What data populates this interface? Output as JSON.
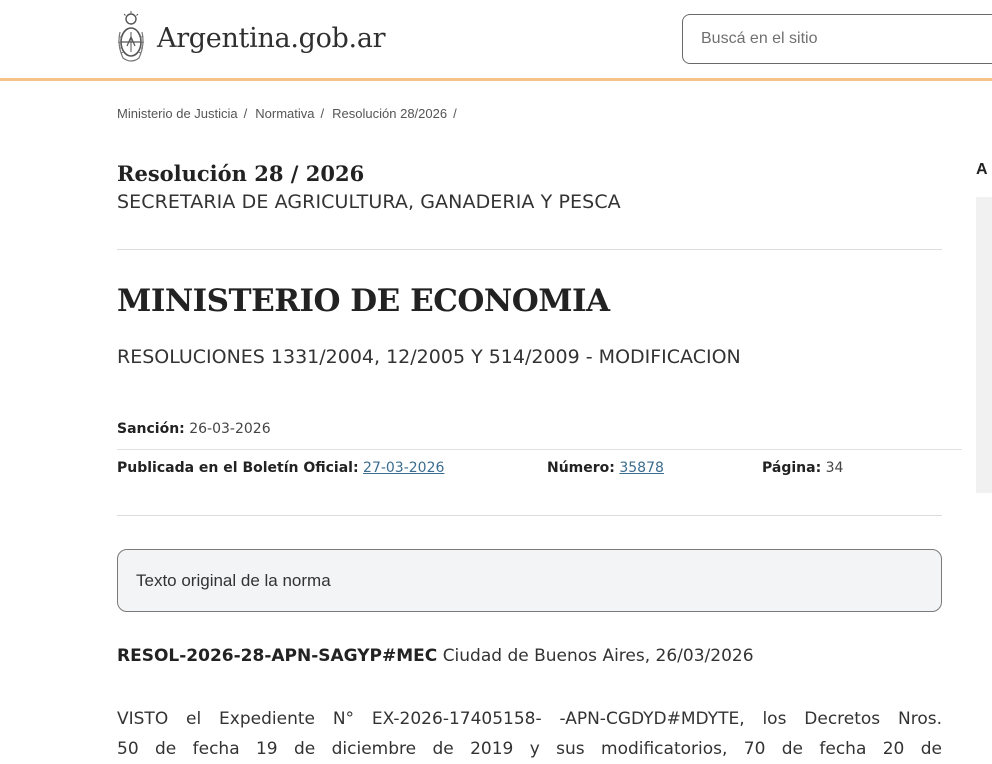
{
  "header": {
    "site_name": "Argentina.gob.ar",
    "search_placeholder": "Buscá en el sitio"
  },
  "breadcrumb": [
    {
      "label": "Ministerio de Justicia"
    },
    {
      "label": "Normativa"
    },
    {
      "label": "Resolución 28/2026"
    }
  ],
  "breadcrumb_separator": "/",
  "norma": {
    "title": "Resolución 28 / 2026",
    "organism": "SECRETARIA DE AGRICULTURA, GANADERIA Y PESCA",
    "ministry": "MINISTERIO DE ECONOMIA",
    "subject": "RESOLUCIONES 1331/2004, 12/2005 Y 514/2009 - MODIFICACION"
  },
  "meta": {
    "sancion_label": "Sanción:",
    "sancion_value": "26-03-2026",
    "publicada_label": "Publicada en el Boletín Oficial:",
    "publicada_value": "27-03-2026",
    "numero_label": "Número:",
    "numero_value": "35878",
    "pagina_label": "Página:",
    "pagina_value": "34"
  },
  "original_text_button": "Texto original de la norma",
  "body": {
    "code": "RESOL-2026-28-APN-SAGYP#MEC",
    "place_date": "Ciudad de Buenos Aires, 26/03/2026",
    "visto_line1": "VISTO el Expediente N° EX-2026-17405158- -APN-CGDYD#MDYTE, los Decretos Nros.",
    "visto_line2": "50 de fecha 19 de diciembre de 2019 y sus modificatorios, 70 de fecha 20 de"
  },
  "sidebar": {
    "heading": "A"
  },
  "colors": {
    "header_border": "#f5c28a",
    "link": "#3b6d8f",
    "box_bg": "#f2f4f5"
  }
}
